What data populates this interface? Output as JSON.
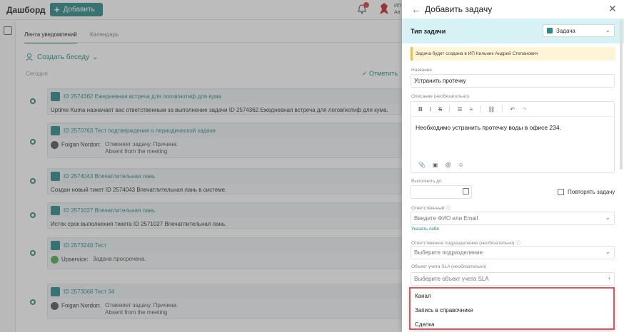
{
  "dashboard": {
    "title": "Дашборд",
    "add_button": "Добавить",
    "user_line1": "ИП",
    "user_line2": "Ав",
    "tabs": [
      "Лента уведомлений",
      "Календарь"
    ],
    "create_chat": "Создать беседу",
    "today_label": "Сегодня",
    "mark_read": "Отметить",
    "feed": [
      {
        "title": "ID 2574362 Ежедневная встреча для логов/нотиф для кума",
        "body": "Uptime Kuma назначает вас ответственным за выполнение задачи ID 2574362 Ежедневная встреча для логов/нотиф для кума."
      },
      {
        "title": "ID 2570763 Тест подтверждения о периодической задаче",
        "sub_name": "Foigan Nordon:",
        "sub_text1": "Отменяет задачу. Причина:",
        "sub_text2": "Absent from the meeting"
      },
      {
        "title": "ID 2574043 Впечатлительная лань",
        "body": "Создан новый тикет ID 2574043 Впечатлительная лань в системе."
      },
      {
        "title": "ID 2571027 Впечатлительная лань",
        "body": "Истек срок выполнения тикета ID 2571027 Впечатлительная лань."
      },
      {
        "title": "ID 2573240 Тест",
        "sub_name": "Upservice:",
        "sub_text1": "Задача просрочена."
      },
      {
        "title": "ID 2573068 Тест 34",
        "sub_name": "Foigan Nordon:",
        "sub_text1": "Отменяет задачу. Причина:",
        "sub_text2": "Absent from the meeting"
      }
    ]
  },
  "panel": {
    "title": "Добавить задачу",
    "type_label": "Тип задачи",
    "type_value": "Задача",
    "notice": "Задача будет создана в ИП Кильник Андрей Степанович",
    "name_label": "Название",
    "name_value": "Устранить протечку",
    "desc_label": "Описание (необязательно)",
    "desc_value": "Необходимо устранить протечку воды в офисе 234.",
    "due_label": "Выполнить до",
    "repeat_label": "Повторять задачу",
    "responsible_label": "Ответственный",
    "responsible_placeholder": "Введите ФИО или Email",
    "assign_me": "Указать себя",
    "dept_label": "Ответственное подразделение (необязательно)",
    "dept_placeholder": "Выберите подразделение",
    "sla_label": "Объект учета SLA (необязательно)",
    "sla_placeholder": "Выберите объект учета SLA",
    "sla_options": [
      "Канал",
      "Запись в справочнике",
      "Сделка"
    ]
  }
}
